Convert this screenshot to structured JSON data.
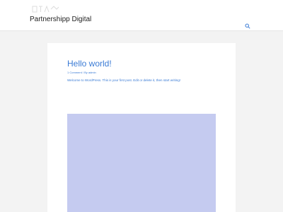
{
  "header": {
    "site_title": "Partnershipp Digital",
    "logo_icon": "logo-mark-icon",
    "search_icon": "search-icon"
  },
  "post": {
    "title": "Hello world!",
    "comments": "1 Comment",
    "separator": "/",
    "author": "By admin",
    "excerpt": "Welcome to WordPress. This is your first post. Edit or delete it, then start writing!",
    "image_color": "#c5cbf0"
  },
  "colors": {
    "accent": "#3a7bd5",
    "background": "#f3f3f3",
    "card": "#ffffff"
  }
}
